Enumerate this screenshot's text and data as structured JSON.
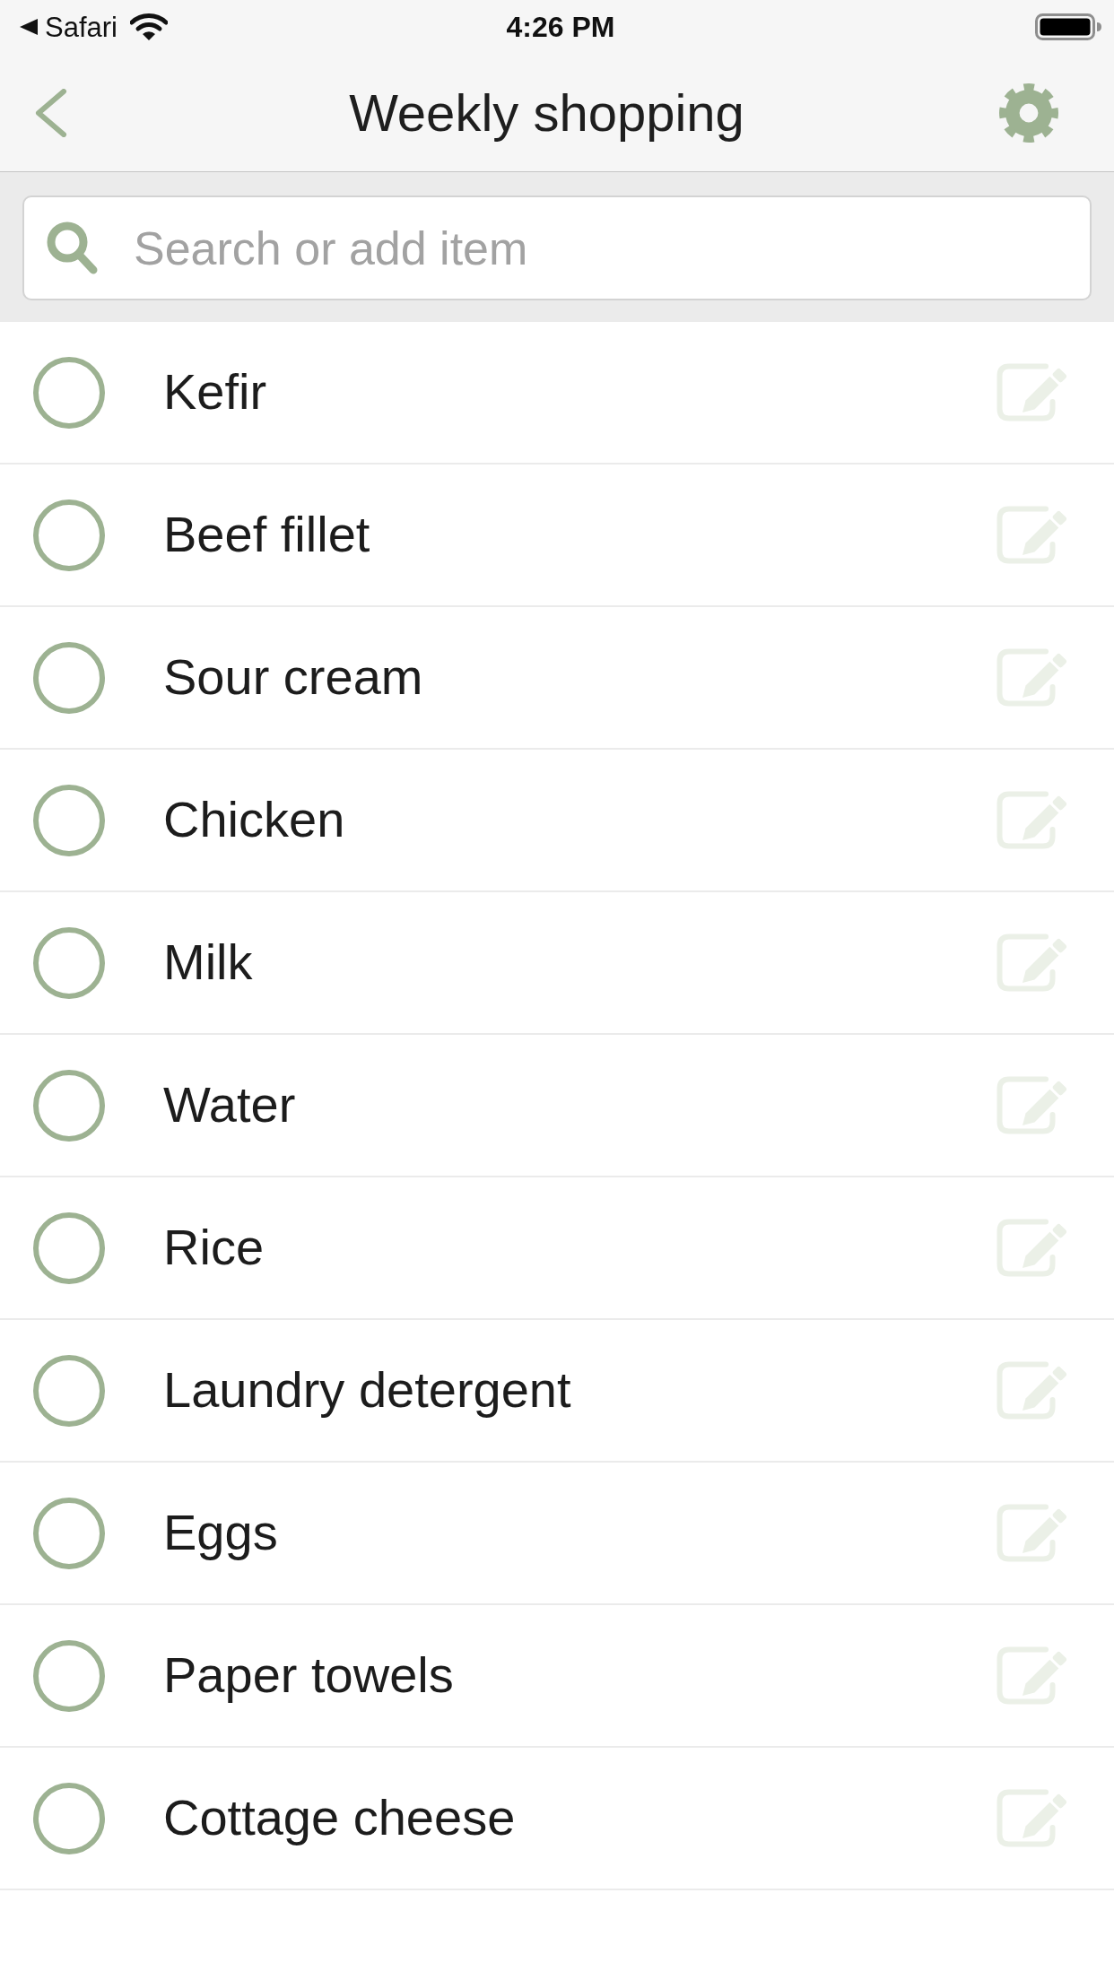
{
  "status_bar": {
    "app": "Safari",
    "time": "4:26 PM"
  },
  "nav_bar": {
    "title": "Weekly shopping"
  },
  "search": {
    "placeholder": "Search or add item"
  },
  "items": [
    {
      "name": "Kefir",
      "checked": false
    },
    {
      "name": "Beef fillet",
      "checked": false
    },
    {
      "name": "Sour cream",
      "checked": false
    },
    {
      "name": "Chicken",
      "checked": false
    },
    {
      "name": "Milk",
      "checked": false
    },
    {
      "name": "Water",
      "checked": false
    },
    {
      "name": "Rice",
      "checked": false
    },
    {
      "name": "Laundry detergent",
      "checked": false
    },
    {
      "name": "Eggs",
      "checked": false
    },
    {
      "name": "Paper towels",
      "checked": false
    },
    {
      "name": "Cottage cheese",
      "checked": false
    }
  ]
}
